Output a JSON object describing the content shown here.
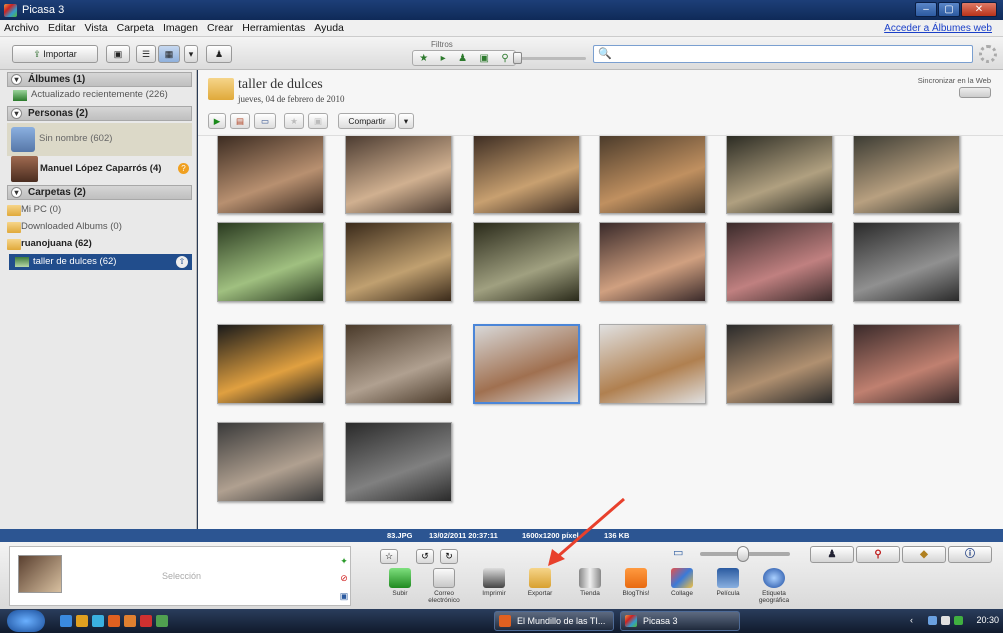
{
  "window": {
    "title": "Picasa 3",
    "controls": [
      "–",
      "▢",
      "✕"
    ]
  },
  "menu": {
    "items": [
      "Archivo",
      "Editar",
      "Vista",
      "Carpeta",
      "Imagen",
      "Crear",
      "Herramientas",
      "Ayuda"
    ],
    "account_link": "Acceder a Álbumes web"
  },
  "toolbar": {
    "import_label": "Importar",
    "filters_label": "Filtros",
    "search_placeholder": ""
  },
  "sidebar": {
    "albums_header": "Álbumes (1)",
    "albums_item": "Actualizado recientemente (226)",
    "people_header": "Personas (2)",
    "unnamed": "Sin nombre (602)",
    "manuel": "Manuel López Caparrós (4)",
    "folders_header": "Carpetas (2)",
    "mypc": "Mi PC (0)",
    "downloaded": "Downloaded Albums (0)",
    "user_folder": "ruanojuana (62)",
    "selected_folder": "taller de dulces (62)"
  },
  "album": {
    "name": "taller de dulces",
    "date": "jueves, 04 de febrero de 2010",
    "sync_label": "Sincronizar en la Web",
    "share_label": "Compartir"
  },
  "status": {
    "filename": "83.JPG",
    "datetime": "13/02/2011 20:37:11",
    "dims": "1600x1200 píxel",
    "size": "136 KB"
  },
  "tray": {
    "selection_label": "Selección"
  },
  "tools": {
    "upload": "Subir",
    "email": "Correo electrónico",
    "print": "Imprimir",
    "export": "Exportar",
    "shop": "Tienda",
    "blog": "BlogThis!",
    "collage": "Collage",
    "movie": "Película",
    "geotag": "Etiqueta geográfica"
  },
  "taskbar": {
    "task1": "El Mundillo de las TI...",
    "task2": "Picasa 3",
    "clock": "20:30"
  },
  "photo_grid": {
    "count": 20,
    "selected_index": 14
  },
  "colors": {
    "titlebar": "#1d3f78",
    "selection": "#214d8c",
    "statusbar": "#2c5592",
    "arrow": "#e8402c"
  }
}
